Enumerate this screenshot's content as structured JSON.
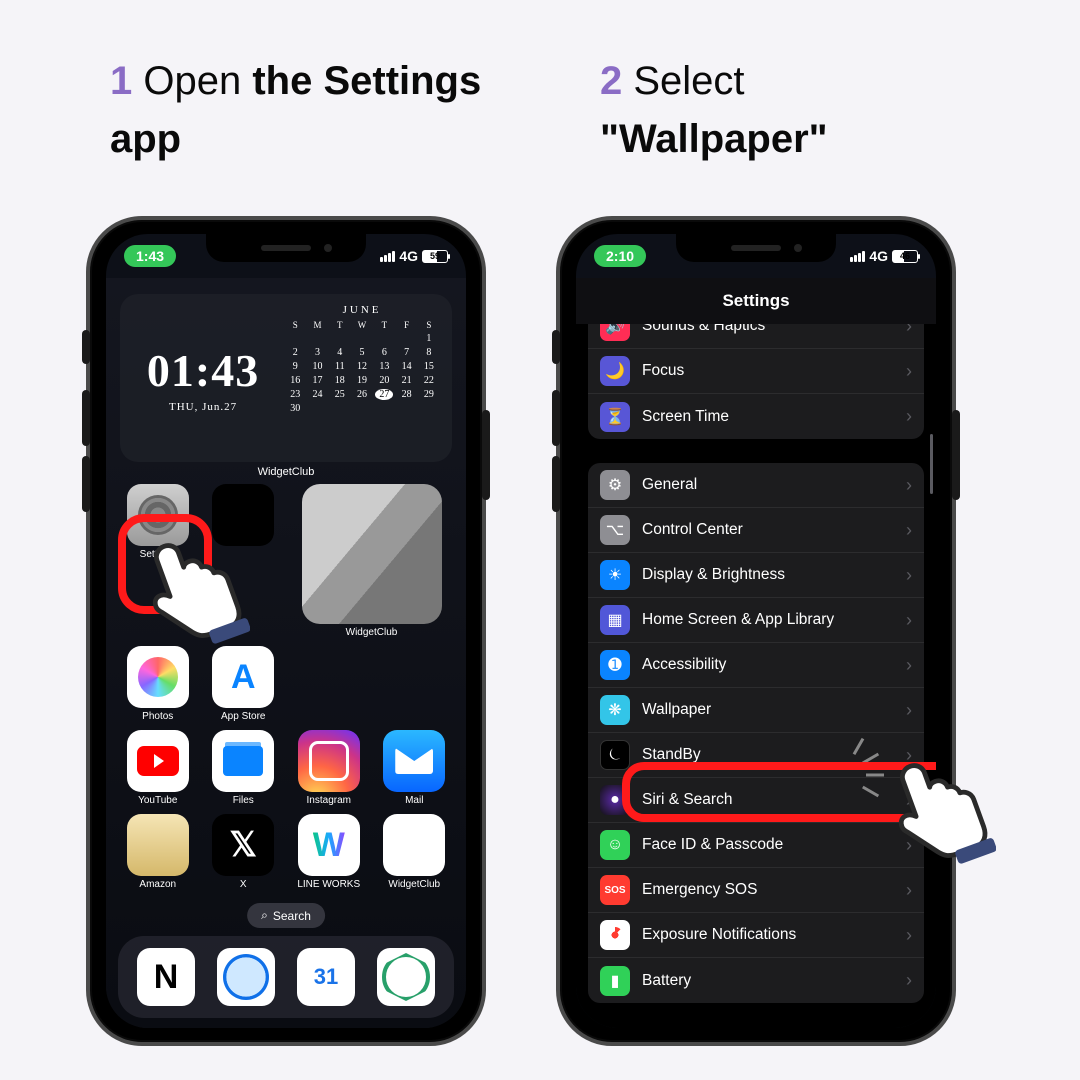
{
  "steps": {
    "s1_num": "1",
    "s1_l1": " Open ",
    "s1_l2": "the Settings app",
    "s2_num": "2",
    "s2_l1": " Select",
    "s2_l2": "\"Wallpaper\""
  },
  "phone1": {
    "status": {
      "time": "1:43",
      "net": "4G",
      "batt": "59"
    },
    "widget": {
      "time": "01:43",
      "date": "THU, Jun.27",
      "month": "JUNE",
      "weekdays": [
        "S",
        "M",
        "T",
        "W",
        "T",
        "F",
        "S"
      ],
      "today": 27,
      "label": "WidgetClub"
    },
    "apps": {
      "settings": "Settings",
      "wallet": "",
      "photos": "Photos",
      "appstore": "App Store",
      "widgetclub_photo": "WidgetClub",
      "youtube": "YouTube",
      "files": "Files",
      "instagram": "Instagram",
      "mail": "Mail",
      "amazon": "Amazon",
      "x": "X",
      "lineworks": "LINE WORKS",
      "widgetclub": "WidgetClub"
    },
    "search": "Search"
  },
  "phone2": {
    "status": {
      "time": "2:10",
      "net": "4G",
      "batt": "46"
    },
    "title": "Settings",
    "group1": [
      {
        "icon": "sounds",
        "label": "Sounds & Haptics"
      },
      {
        "icon": "focus",
        "label": "Focus"
      },
      {
        "icon": "screentime",
        "label": "Screen Time"
      }
    ],
    "group2": [
      {
        "icon": "general",
        "label": "General"
      },
      {
        "icon": "control",
        "label": "Control Center"
      },
      {
        "icon": "display",
        "label": "Display & Brightness"
      },
      {
        "icon": "home",
        "label": "Home Screen & App Library"
      },
      {
        "icon": "access",
        "label": "Accessibility"
      },
      {
        "icon": "wallpaper",
        "label": "Wallpaper"
      },
      {
        "icon": "standby",
        "label": "StandBy"
      },
      {
        "icon": "siri",
        "label": "Siri & Search"
      },
      {
        "icon": "faceid",
        "label": "Face ID & Passcode"
      },
      {
        "icon": "sos",
        "label": "Emergency SOS"
      },
      {
        "icon": "exposure",
        "label": "Exposure Notifications"
      },
      {
        "icon": "battery",
        "label": "Battery"
      }
    ]
  },
  "calendar_days": [
    "",
    "",
    "",
    "",
    "",
    "",
    1,
    2,
    3,
    4,
    5,
    6,
    7,
    8,
    9,
    10,
    11,
    12,
    13,
    14,
    15,
    16,
    17,
    18,
    19,
    20,
    21,
    22,
    23,
    24,
    25,
    26,
    27,
    28,
    29,
    30
  ]
}
